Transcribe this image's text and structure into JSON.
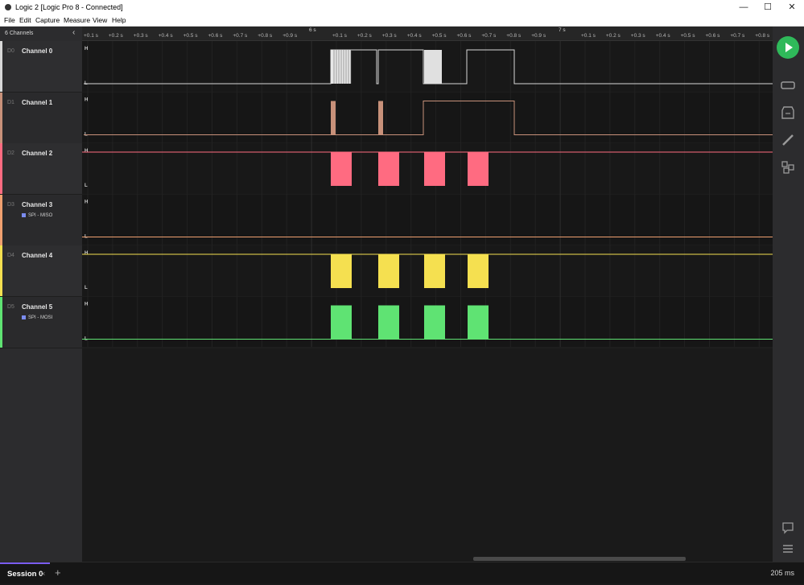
{
  "window": {
    "title": "Logic 2 [Logic Pro 8 - Connected]",
    "minimize": "—",
    "maximize": "☐",
    "close": "✕"
  },
  "menu": [
    "File",
    "Edit",
    "Capture",
    "Measure",
    "View",
    "Help"
  ],
  "sidebar": {
    "header": "6 Channels",
    "collapse_glyph": "‹"
  },
  "channels": [
    {
      "id": "D0",
      "name": "Channel 0",
      "color": "#d7d7d7",
      "analyzer": ""
    },
    {
      "id": "D1",
      "name": "Channel 1",
      "color": "#c8917a",
      "analyzer": ""
    },
    {
      "id": "D2",
      "name": "Channel 2",
      "color": "#ff6b81",
      "analyzer": ""
    },
    {
      "id": "D3",
      "name": "Channel 3",
      "color": "#f0a070",
      "analyzer": "SPI - MISO"
    },
    {
      "id": "D4",
      "name": "Channel 4",
      "color": "#f5e050",
      "analyzer": ""
    },
    {
      "id": "D5",
      "name": "Channel 5",
      "color": "#5fe373",
      "analyzer": "SPI - MOSI"
    }
  ],
  "level_labels": {
    "high": "H",
    "low": "L"
  },
  "timeline": {
    "major_labels": [
      "6 s",
      "7 s"
    ],
    "tick_labels": [
      "+0.1 s",
      "+0.2 s",
      "+0.3 s",
      "+0.4 s",
      "+0.5 s",
      "+0.6 s",
      "+0.7 s",
      "+0.8 s",
      "+0.9 s",
      "+0.1 s",
      "+0.2 s",
      "+0.3 s",
      "+0.4 s",
      "+0.5 s",
      "+0.6 s",
      "+0.7 s",
      "+0.8 s",
      "+0.9 s",
      "+0.1 s",
      "+0.2 s",
      "+0.3 s",
      "+0.4 s",
      "+0.5 s",
      "+0.6 s",
      "+0.7 s",
      "+0.8 s"
    ]
  },
  "right_toolbar": {
    "start_icon": "play-icon",
    "icons": [
      "device-icon",
      "analyzer-icon",
      "measure-icon",
      "extensions-icon",
      "chat-icon",
      "menu-icon"
    ]
  },
  "bottom": {
    "session_label": "Session 0",
    "session_close": "×",
    "add_tab": "+",
    "timing": "205 ms"
  }
}
